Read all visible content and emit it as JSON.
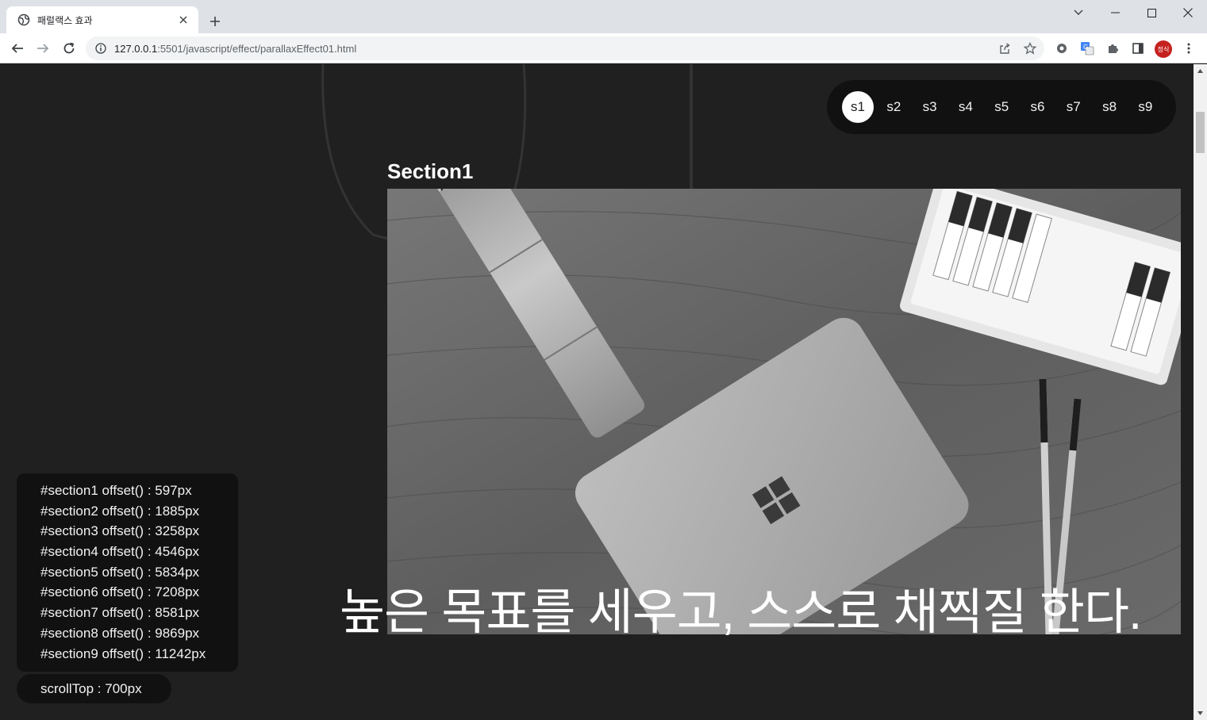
{
  "browser": {
    "tab_title": "패럴랙스 효과",
    "url_host": "127.0.0.1",
    "url_path": ":5501/javascript/effect/parallaxEffect01.html",
    "profile_label": "정식"
  },
  "nav": {
    "items": [
      "s1",
      "s2",
      "s3",
      "s4",
      "s5",
      "s6",
      "s7",
      "s8",
      "s9"
    ],
    "active": "s1"
  },
  "section": {
    "title": "Section1",
    "slogan": "높은 목표를 세우고, 스스로 채찍질 한다."
  },
  "offsets": [
    "#section1 offset() : 597px",
    "#section2 offset() : 1885px",
    "#section3 offset() : 3258px",
    "#section4 offset() : 4546px",
    "#section5 offset() : 5834px",
    "#section6 offset() : 7208px",
    "#section7 offset() : 8581px",
    "#section8 offset() : 9869px",
    "#section9 offset() : 11242px"
  ],
  "scroll_top": "scrollTop : 700px",
  "colors": {
    "page_bg": "#202020",
    "panel_bg": "#111111",
    "active_nav": "#ffffff"
  }
}
